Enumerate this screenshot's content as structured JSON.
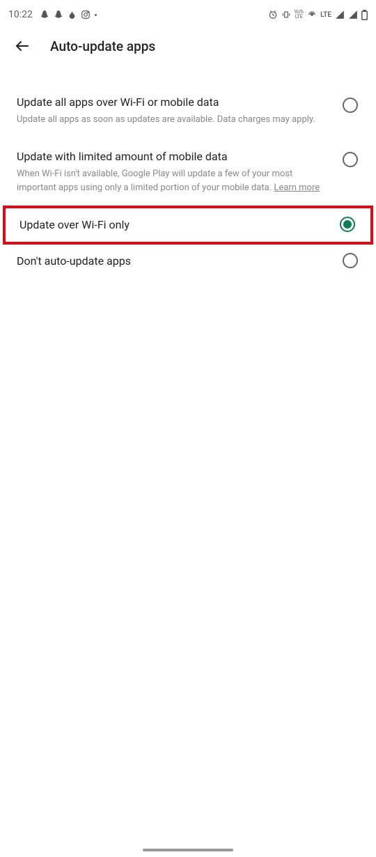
{
  "status_bar": {
    "time": "10:22",
    "lte_label": "LTE",
    "volte_label": "Vo\nLTE"
  },
  "header": {
    "title": "Auto-update apps"
  },
  "options": [
    {
      "title": "Update all apps over Wi-Fi or mobile data",
      "subtitle": "Update all apps as soon as updates are available. Data charges may apply.",
      "selected": false
    },
    {
      "title": "Update with limited amount of mobile data",
      "subtitle_pre": "When Wi-Fi isn't available, Google Play will update a few of your most important apps using only a limited portion of your mobile data. ",
      "learn_more": "Learn more",
      "selected": false
    },
    {
      "title": "Update over Wi-Fi only",
      "selected": true,
      "highlighted": true
    },
    {
      "title": "Don't auto-update apps",
      "selected": false
    }
  ]
}
